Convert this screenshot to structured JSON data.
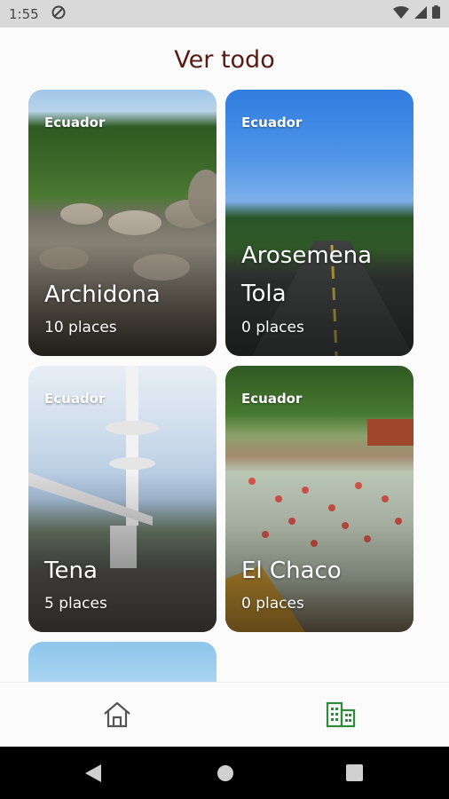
{
  "status_bar": {
    "time": "1:55"
  },
  "header": {
    "title": "Ver todo"
  },
  "cards": [
    {
      "country": "Ecuador",
      "name": "Archidona",
      "count": "10 places"
    },
    {
      "country": "Ecuador",
      "name_line1": "Arosemena",
      "name_line2": "Tola",
      "count": "0 places"
    },
    {
      "country": "Ecuador",
      "name": "Tena",
      "count": "5 places"
    },
    {
      "country": "Ecuador",
      "name": "El Chaco",
      "count": "0 places"
    }
  ],
  "bottom_nav": {
    "items": [
      {
        "icon": "home-icon"
      },
      {
        "icon": "buildings-icon",
        "active": true
      }
    ]
  },
  "colors": {
    "title": "#5a1a14",
    "active_nav": "#2e8b3a",
    "inactive_nav": "#555555"
  }
}
